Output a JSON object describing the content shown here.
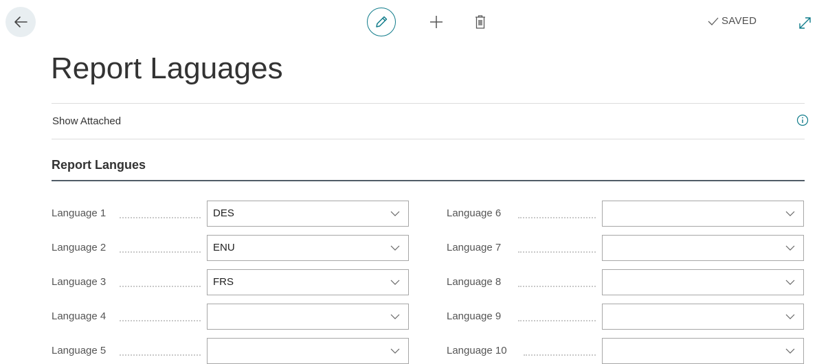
{
  "header": {
    "back_icon": "arrow-left-icon",
    "tools": {
      "edit_icon": "pencil-icon",
      "add_icon": "plus-icon",
      "delete_icon": "trash-icon"
    },
    "saved_label": "SAVED",
    "expand_icon": "expand-icon"
  },
  "page": {
    "title": "Report Laguages"
  },
  "actions": {
    "show_attached": "Show Attached"
  },
  "section": {
    "title": "Report Langues"
  },
  "fields_left": [
    {
      "label": "Language 1",
      "value": "DES"
    },
    {
      "label": "Language 2",
      "value": "ENU"
    },
    {
      "label": "Language 3",
      "value": "FRS"
    },
    {
      "label": "Language 4",
      "value": ""
    },
    {
      "label": "Language 5",
      "value": ""
    }
  ],
  "fields_right": [
    {
      "label": "Language 6",
      "value": ""
    },
    {
      "label": "Language 7",
      "value": ""
    },
    {
      "label": "Language 8",
      "value": ""
    },
    {
      "label": "Language 9",
      "value": ""
    },
    {
      "label": "Language 10",
      "value": ""
    }
  ],
  "colors": {
    "accent": "#0f7b8a",
    "back_button_bg": "#e8eef1",
    "section_rule": "#505c66"
  }
}
